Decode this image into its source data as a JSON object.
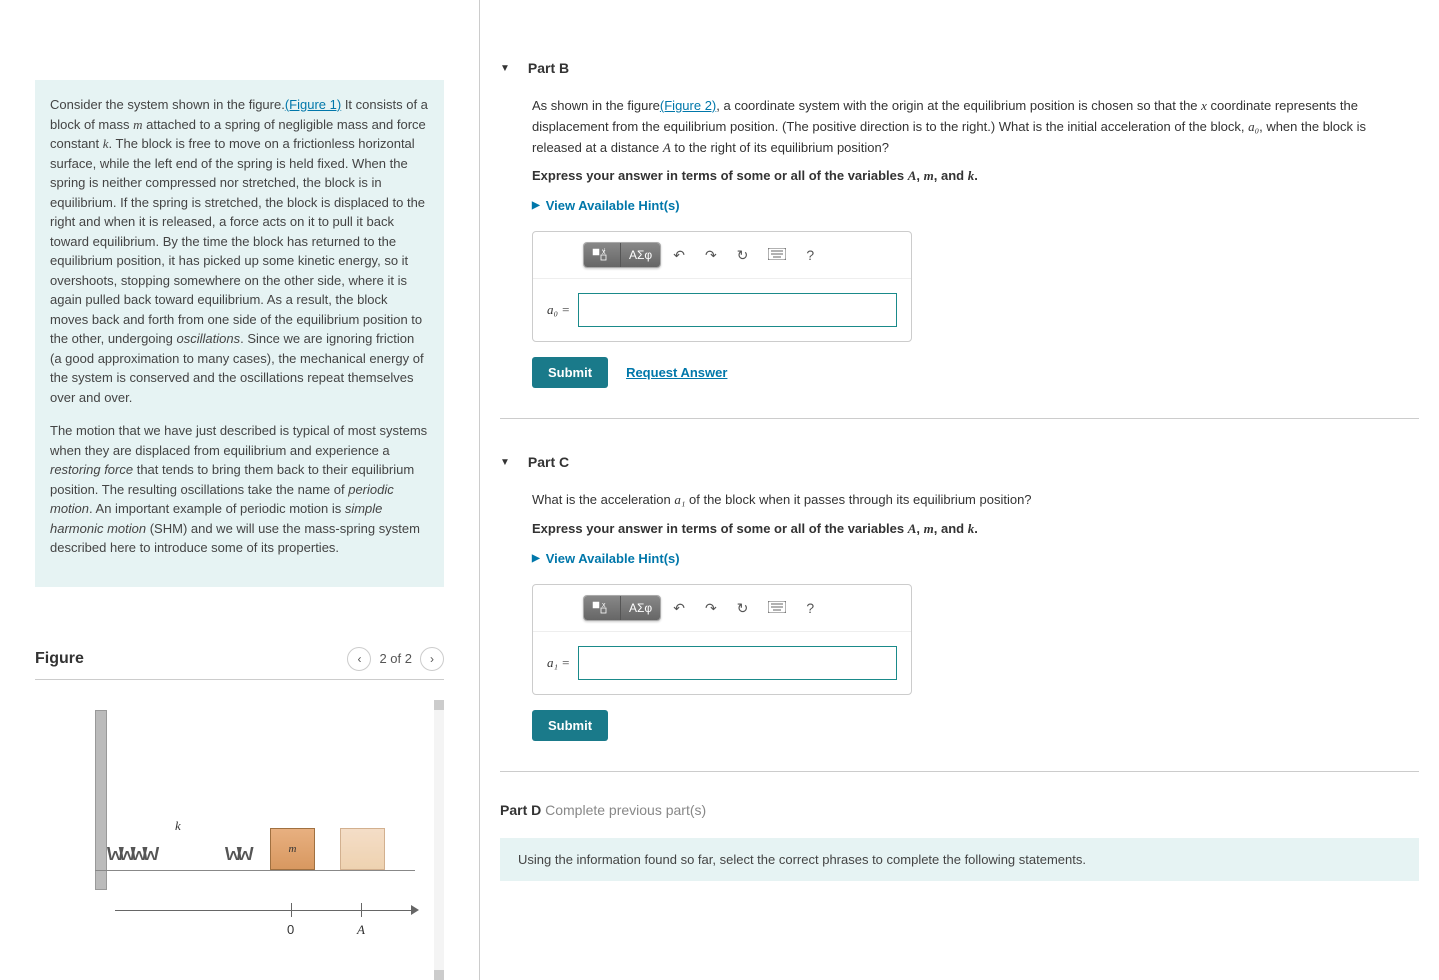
{
  "problem": {
    "paragraph1": {
      "text1": "Consider the system shown in the figure.",
      "figure1_link": "(Figure 1)",
      "text2": " It consists of a block of mass ",
      "var_m": "m",
      "text3": " attached to a spring of negligible mass and force constant ",
      "var_k": "k",
      "text4": ". The block is free to move on a frictionless horizontal surface, while the left end of the spring is held fixed. When the spring is neither compressed nor stretched, the block is in equilibrium. If the spring is stretched, the block is displaced to the right and when it is released, a force acts on it to pull it back toward equilibrium. By the time the block has returned to the equilibrium position, it has picked up some kinetic energy, so it overshoots, stopping somewhere on the other side, where it is again pulled back toward equilibrium. As a result, the block moves back and forth from one side of the equilibrium position to the other, undergoing ",
      "italic_osc": "oscillations",
      "text5": ". Since we are ignoring friction (a good approximation to many cases), the mechanical energy of the system is conserved and the oscillations repeat themselves over and over."
    },
    "paragraph2": {
      "text1": "The motion that we have just described is typical of most systems when they are displaced from equilibrium and experience a ",
      "italic_rf": "restoring force",
      "text2": " that tends to bring them back to their equilibrium position. The resulting oscillations take the name of ",
      "italic_pm": "periodic motion",
      "text3": ". An important example of periodic motion is ",
      "italic_shm": "simple harmonic motion",
      "text4": " (SHM) and we will use the mass-spring system described here to introduce some of its properties."
    }
  },
  "figure": {
    "title": "Figure",
    "counter": "2 of 2",
    "k_label": "k",
    "m_label": "m",
    "zero_label": "0",
    "A_label": "A"
  },
  "partB": {
    "header": "Part B",
    "q_text1": "As shown in the figure",
    "fig2_link": "(Figure 2)",
    "q_text2": ", a coordinate system with the origin at the equilibrium position is chosen so that the ",
    "var_x": "x",
    "q_text3": " coordinate represents the displacement from the equilibrium position. (The positive direction is to the right.) What is the initial acceleration of the block, ",
    "var_a0": "a₀",
    "q_text4": ", when the block is released at a distance ",
    "var_A": "A",
    "q_text5": " to the right of its equilibrium position?",
    "instruction_pre": "Express your answer in terms of some or all of the variables ",
    "inst_A": "A",
    "inst_comma1": ", ",
    "inst_m": "m",
    "inst_and": ", and ",
    "inst_k": "k",
    "inst_period": ".",
    "hints": "View Available Hint(s)",
    "input_label": "a₀ =",
    "submit": "Submit",
    "request": "Request Answer",
    "greek": "ΑΣφ"
  },
  "partC": {
    "header": "Part C",
    "q_text1": "What is the acceleration ",
    "var_a1": "a₁",
    "q_text2": " of the block when it passes through its equilibrium position?",
    "instruction_pre": "Express your answer in terms of some or all of the variables ",
    "inst_A": "A",
    "inst_comma1": ", ",
    "inst_m": "m",
    "inst_and": ", and ",
    "inst_k": "k",
    "inst_period": ".",
    "hints": "View Available Hint(s)",
    "input_label": "a₁ =",
    "submit": "Submit",
    "greek": "ΑΣφ"
  },
  "partD": {
    "header_bold": "Part D",
    "header_gray": "   Complete previous part(s)",
    "info": "Using the information found so far, select the correct phrases to complete the following statements."
  },
  "toolbar_help": "?"
}
